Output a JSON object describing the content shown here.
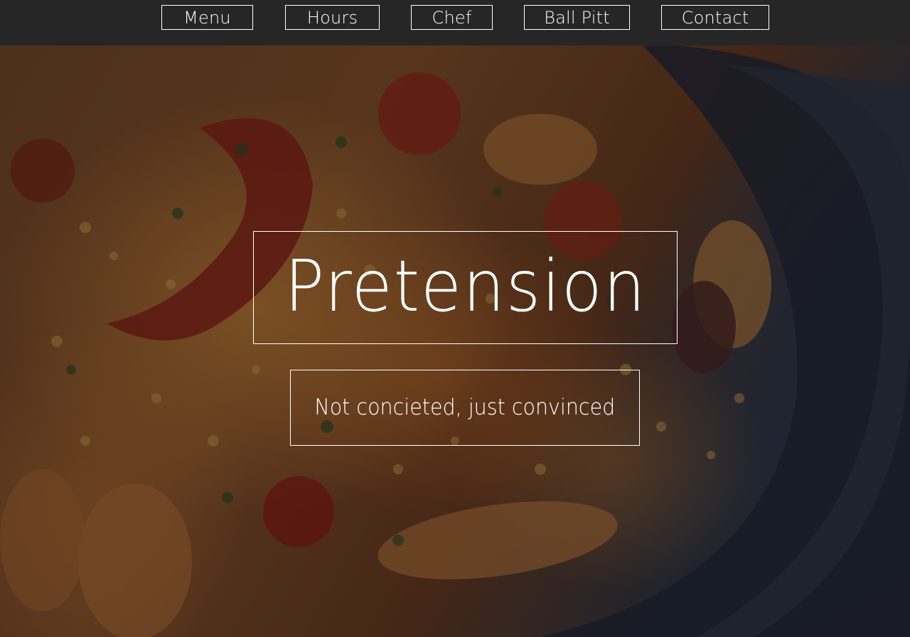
{
  "nav": {
    "items": [
      {
        "label": "Menu"
      },
      {
        "label": "Hours"
      },
      {
        "label": "Chef"
      },
      {
        "label": "Ball Pitt"
      },
      {
        "label": "Contact"
      }
    ]
  },
  "hero": {
    "title": "Pretension",
    "tagline": "Not concieted, just convinced",
    "background_image": "paella-dish-photo"
  },
  "colors": {
    "nav_background": "#262626",
    "text": "#ffffff",
    "border": "#ffffff"
  }
}
